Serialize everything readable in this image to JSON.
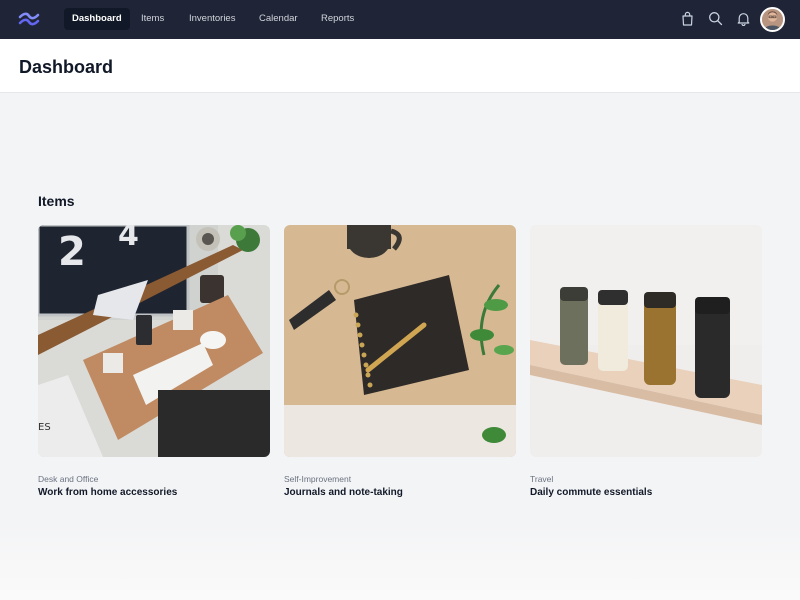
{
  "nav": {
    "items": [
      {
        "label": "Dashboard",
        "active": true
      },
      {
        "label": "Items",
        "active": false
      },
      {
        "label": "Inventories",
        "active": false
      },
      {
        "label": "Calendar",
        "active": false
      },
      {
        "label": "Reports",
        "active": false
      }
    ],
    "icons": [
      "shopping-bag-icon",
      "search-icon",
      "bell-icon"
    ],
    "colors": {
      "background": "#1f2437",
      "active": "#111827",
      "logo": "#6366f1"
    }
  },
  "header": {
    "title": "Dashboard"
  },
  "items_section": {
    "title": "Items",
    "cards": [
      {
        "category": "Desk and Office",
        "name": "Work from home accessories"
      },
      {
        "category": "Self-Improvement",
        "name": "Journals and note-taking"
      },
      {
        "category": "Travel",
        "name": "Daily commute essentials"
      }
    ]
  }
}
